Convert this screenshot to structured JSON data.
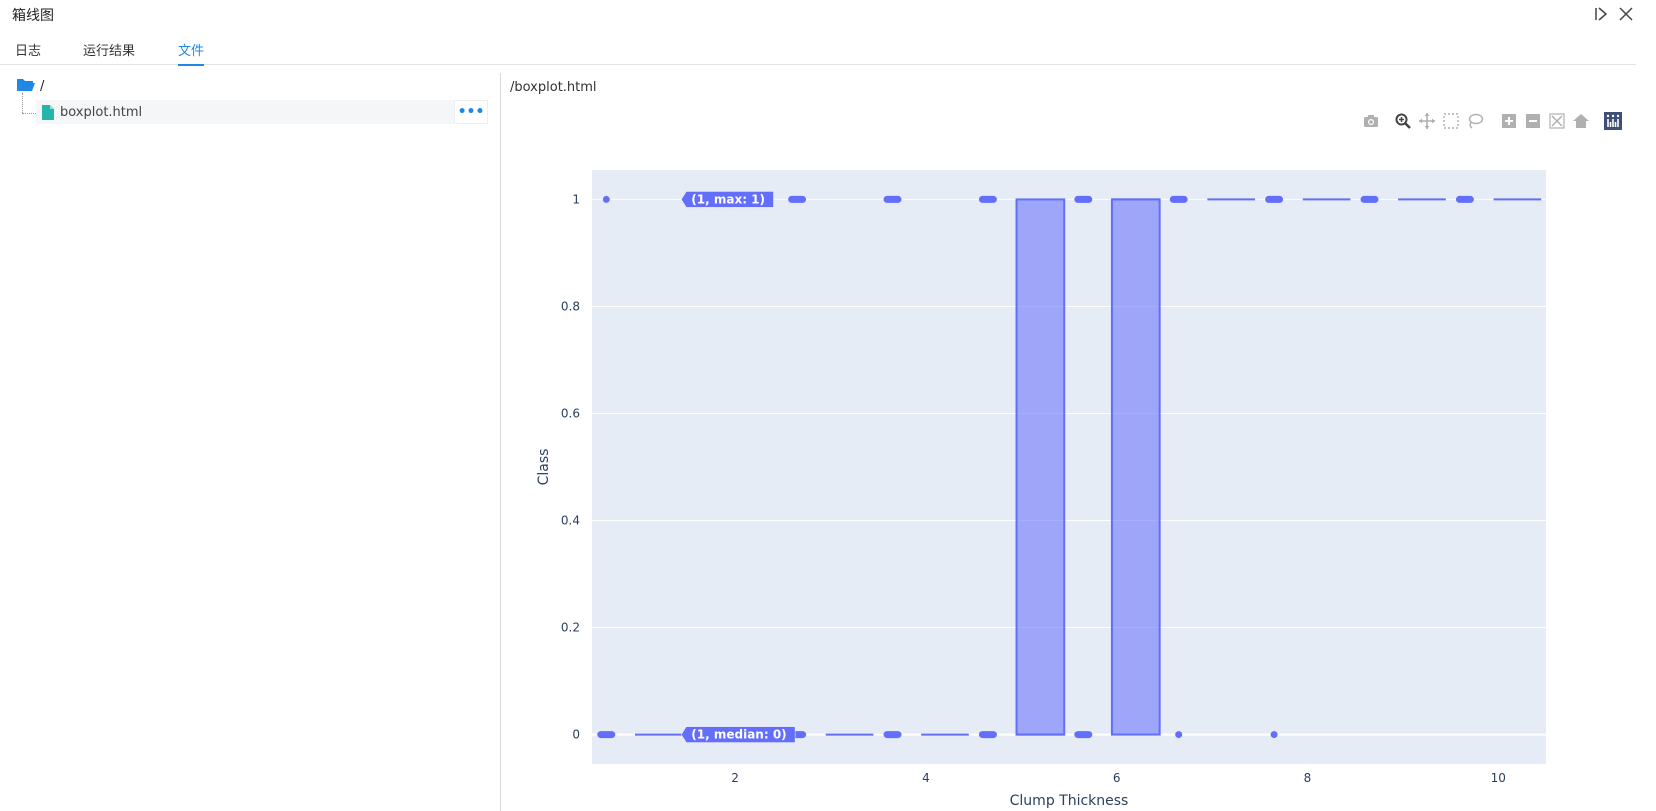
{
  "window": {
    "title": "箱线图"
  },
  "tabs": [
    {
      "label": "日志",
      "active": false
    },
    {
      "label": "运行结果",
      "active": false
    },
    {
      "label": "文件",
      "active": true
    }
  ],
  "tree": {
    "root": "/",
    "file": "boxplot.html",
    "more": "•••"
  },
  "viewer": {
    "path": "/boxplot.html"
  },
  "toolbar": [
    "camera-icon",
    "zoom-icon",
    "pan-icon",
    "box-select-icon",
    "lasso-icon",
    "zoom-in-icon",
    "zoom-out-icon",
    "autoscale-icon",
    "reset-axes-icon",
    "plotly-logo-icon"
  ],
  "colors": {
    "accent": "#1e88e5",
    "box": "#636efa",
    "plotBg": "#e5ecf6"
  },
  "chart_data": {
    "type": "box",
    "xlabel": "Clump Thickness",
    "ylabel": "Class",
    "xlim": [
      0.5,
      10.5
    ],
    "ylim": [
      -0.055,
      1.055
    ],
    "xticks": [
      2,
      4,
      6,
      8,
      10
    ],
    "yticks": [
      0,
      0.2,
      0.4,
      0.6,
      0.8,
      1
    ],
    "boxes": [
      {
        "x": 1,
        "q1": 0,
        "median": 0,
        "q3": 0,
        "min": 0,
        "max": 0,
        "outliers": [
          1
        ]
      },
      {
        "x": 3,
        "q1": 0,
        "median": 0,
        "q3": 0,
        "min": 0,
        "max": 0,
        "outliers": [
          1
        ]
      },
      {
        "x": 4,
        "q1": 0,
        "median": 0,
        "q3": 0,
        "min": 0,
        "max": 0,
        "outliers": [
          1
        ]
      },
      {
        "x": 5,
        "q1": 0,
        "median": 0,
        "q3": 1,
        "min": 0,
        "max": 1,
        "outliers": []
      },
      {
        "x": 6,
        "q1": 0,
        "median": 1,
        "q3": 1,
        "min": 0,
        "max": 1,
        "outliers": []
      },
      {
        "x": 7,
        "q1": 1,
        "median": 1,
        "q3": 1,
        "min": 1,
        "max": 1,
        "outliers": [
          0
        ]
      },
      {
        "x": 8,
        "q1": 1,
        "median": 1,
        "q3": 1,
        "min": 1,
        "max": 1,
        "outliers": [
          0
        ]
      },
      {
        "x": 9,
        "q1": 1,
        "median": 1,
        "q3": 1,
        "min": 1,
        "max": 1,
        "outliers": []
      },
      {
        "x": 10,
        "q1": 1,
        "median": 1,
        "q3": 1,
        "min": 1,
        "max": 1,
        "outliers": []
      }
    ],
    "hover_labels": [
      {
        "text": "(1, max: 1)",
        "x": 1,
        "y": 1
      },
      {
        "text": "(1, median: 0)",
        "x": 1,
        "y": 0
      }
    ]
  }
}
